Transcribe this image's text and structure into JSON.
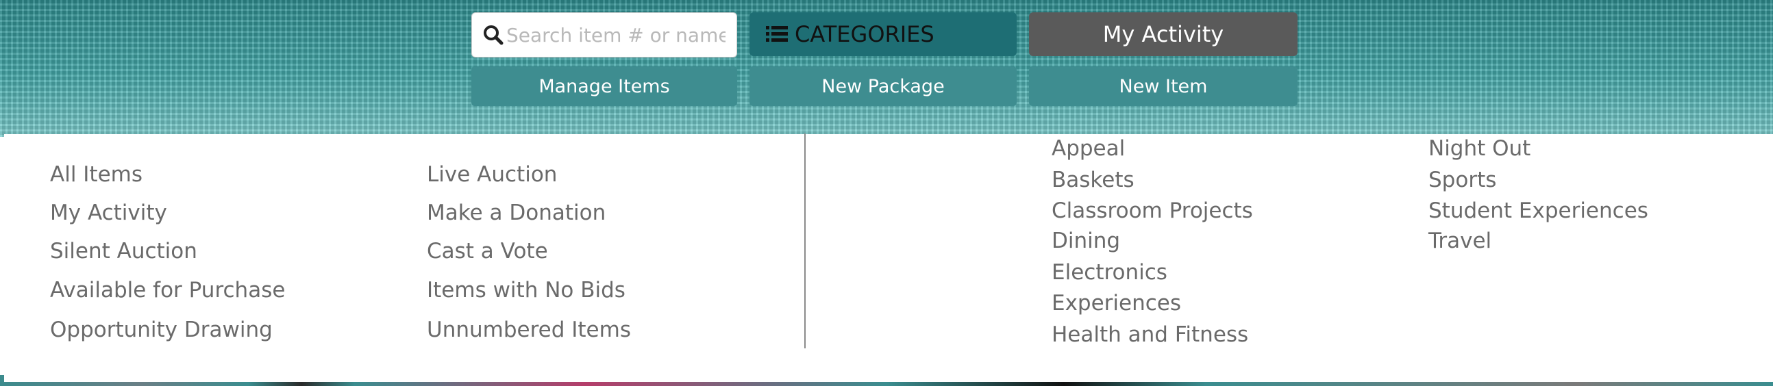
{
  "search": {
    "placeholder": "Search item # or name"
  },
  "top_buttons": {
    "categories": "CATEGORIES",
    "my_activity": "My Activity"
  },
  "sub_buttons": {
    "manage_items": "Manage Items",
    "new_package": "New Package",
    "new_item": "New Item"
  },
  "menu": {
    "col1": [
      "All Items",
      "My Activity",
      "Silent Auction",
      "Available for Purchase",
      "Opportunity Drawing"
    ],
    "col2": [
      "Live Auction",
      "Make a Donation",
      "Cast a Vote",
      "Items with No Bids",
      "Unnumbered Items"
    ],
    "col3": [
      "Appeal",
      "Baskets",
      "Classroom Projects",
      "Dining",
      "Electronics",
      "Experiences",
      "Health and Fitness"
    ],
    "col4": [
      "Night Out",
      "Sports",
      "Student Experiences",
      "Travel"
    ]
  },
  "colors": {
    "header_teal": "#3fa3a4",
    "categories_bg": "#1e6e74",
    "activity_bg": "#5a5a5a",
    "sub_button_bg": "#3e8d90",
    "menu_text": "#6a6a6a"
  },
  "icons": {
    "search": "search-icon",
    "categories": "list-icon"
  }
}
